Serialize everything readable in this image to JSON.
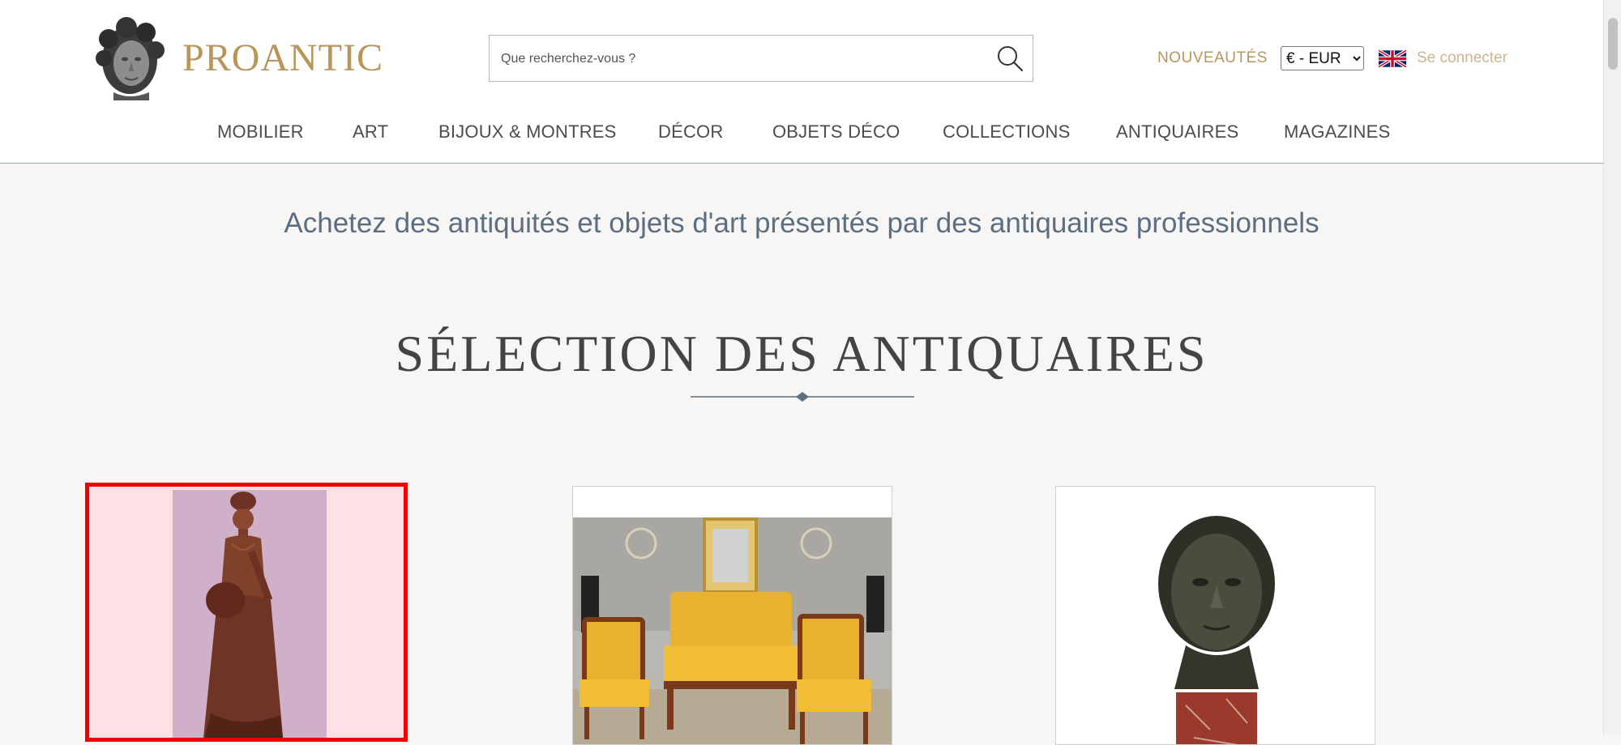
{
  "header": {
    "brand": "PROANTIC",
    "search_placeholder": "Que recherchez-vous ?",
    "new_label": "NOUVEAUTÉS",
    "currency_options": [
      "€ - EUR"
    ],
    "currency_selected": "€ - EUR",
    "language_flag": "uk-flag-icon",
    "login_label": "Se connecter"
  },
  "nav": {
    "items": [
      {
        "label": "MOBILIER"
      },
      {
        "label": "ART"
      },
      {
        "label": "BIJOUX & MONTRES"
      },
      {
        "label": "DÉCOR"
      },
      {
        "label": "OBJETS DÉCO"
      },
      {
        "label": "COLLECTIONS"
      },
      {
        "label": "ANTIQUAIRES"
      },
      {
        "label": "MAGAZINES"
      }
    ]
  },
  "main": {
    "tagline": "Achetez des antiquités et objets d'art présentés par des antiquaires professionnels",
    "section_title": "SÉLECTION DES ANTIQUAIRES",
    "cards": [
      {
        "image": "bronze-statue-woman-with-jug",
        "selected": true
      },
      {
        "image": "empire-salon-furniture-set",
        "selected": false
      },
      {
        "image": "bronze-head-bust-on-marble",
        "selected": false
      }
    ]
  },
  "colors": {
    "brand_gold": "#b8955a",
    "tagline_blue": "#5c6f82",
    "selection_red": "#ee0000"
  }
}
